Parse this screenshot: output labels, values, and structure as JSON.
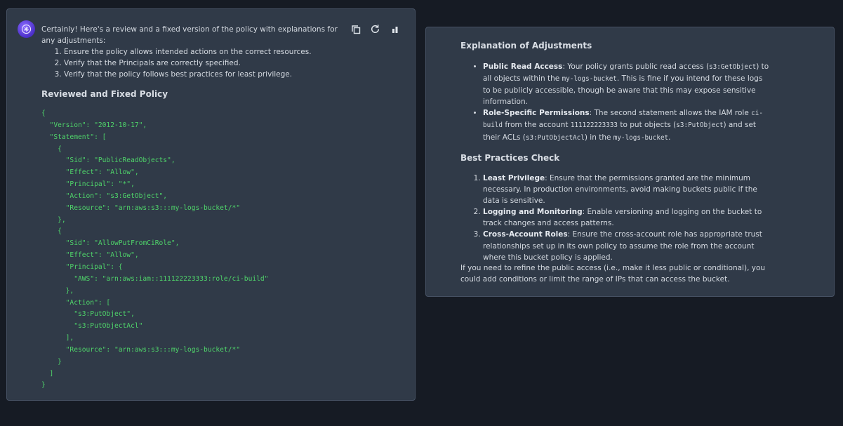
{
  "left": {
    "intro": "Certainly! Here's a review and a fixed version of the policy with explanations for any adjustments:",
    "steps": [
      "Ensure the policy allows intended actions on the correct resources.",
      "Verify that the Principals are correctly specified.",
      "Verify that the policy follows best practices for least privilege."
    ],
    "heading": "Reviewed and Fixed Policy",
    "code": "{\n  \"Version\": \"2012-10-17\",\n  \"Statement\": [\n    {\n      \"Sid\": \"PublicReadObjects\",\n      \"Effect\": \"Allow\",\n      \"Principal\": \"*\",\n      \"Action\": \"s3:GetObject\",\n      \"Resource\": \"arn:aws:s3:::my-logs-bucket/*\"\n    },\n    {\n      \"Sid\": \"AllowPutFromCiRole\",\n      \"Effect\": \"Allow\",\n      \"Principal\": {\n        \"AWS\": \"arn:aws:iam::111122223333:role/ci-build\"\n      },\n      \"Action\": [\n        \"s3:PutObject\",\n        \"s3:PutObjectAcl\"\n      ],\n      \"Resource\": \"arn:aws:s3:::my-logs-bucket/*\"\n    }\n  ]\n}",
    "toolbar_icons": [
      "copy-icon",
      "regenerate-icon",
      "stats-icon"
    ]
  },
  "right": {
    "heading1": "Explanation of Adjustments",
    "b1": {
      "label": "Public Read Access",
      "t1": ": Your policy grants public read access (",
      "c1": "s3:GetObject",
      "t2": ") to all objects within the ",
      "c2": "my-logs-bucket",
      "t3": ". This is fine if you intend for these logs to be publicly accessible, though be aware that this may expose sensitive information."
    },
    "b2": {
      "label": "Role-Specific Permissions",
      "t1": ": The second statement allows the IAM role ",
      "c1": "ci-build",
      "t2": " from the account ",
      "c2": "111122223333",
      "t3": " to put objects (",
      "c3": "s3:PutObject",
      "t4": ") and set their ACLs (",
      "c4": "s3:PutObjectAcl",
      "t5": ") in the ",
      "c5": "my-logs-bucket",
      "t6": "."
    },
    "heading2": "Best Practices Check",
    "checks": [
      {
        "label": "Least Privilege",
        "text": ": Ensure that the permissions granted are the minimum necessary. In production environments, avoid making buckets public if the data is sensitive."
      },
      {
        "label": "Logging and Monitoring",
        "text": ": Enable versioning and logging on the bucket to track changes and access patterns."
      },
      {
        "label": "Cross-Account Roles",
        "text": ": Ensure the cross-account role has appropriate trust relationships set up in its own policy to assume the role from the account where this bucket policy is applied."
      }
    ],
    "closing": "If you need to refine the public access (i.e., make it less public or conditional), you could add conditions or limit the range of IPs that can access the bucket."
  }
}
